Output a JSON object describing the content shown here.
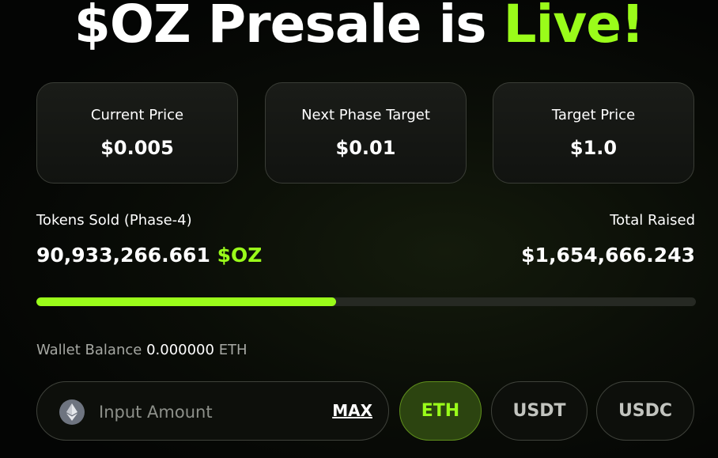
{
  "headline": {
    "prefix": "$OZ Presale is ",
    "accent": "Live!"
  },
  "colors": {
    "accent": "#9afc1a",
    "background": "#0a0d07"
  },
  "price_cards": [
    {
      "label": "Current Price",
      "value": "$0.005"
    },
    {
      "label": "Next Phase Target",
      "value": "$0.01"
    },
    {
      "label": "Target Price",
      "value": "$1.0"
    }
  ],
  "stats": {
    "tokens_sold_label": "Tokens Sold (Phase-4)",
    "tokens_sold_value": "90,933,266.661",
    "tokens_sold_symbol": "$OZ",
    "total_raised_label": "Total Raised",
    "total_raised_value": "$1,654,666.243"
  },
  "progress": {
    "fraction": 0.455
  },
  "wallet": {
    "label": "Wallet Balance",
    "amount": "0.000000",
    "unit": "ETH"
  },
  "purchase": {
    "icon": "ethereum-icon",
    "placeholder": "Input Amount",
    "max_label": "MAX",
    "currencies": [
      "ETH",
      "USDT",
      "USDC"
    ],
    "selected": "ETH"
  }
}
